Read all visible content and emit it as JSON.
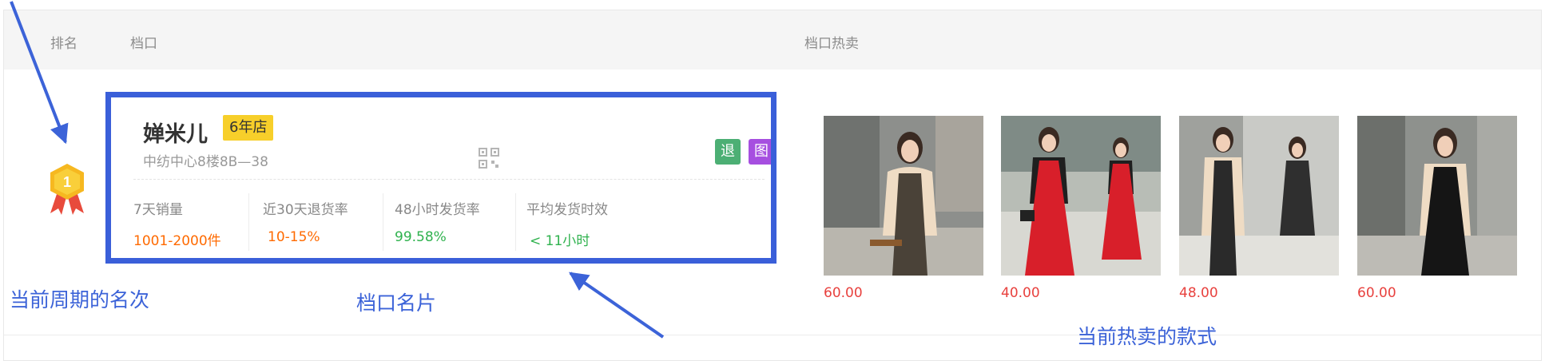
{
  "header": {
    "rank": "排名",
    "stall": "档口",
    "hot": "档口热卖"
  },
  "row": {
    "rank_number": "1",
    "card": {
      "name": "婵米儿",
      "years_badge": "6年店",
      "address": "中纺中心8楼8B—38",
      "tags": [
        "退",
        "图"
      ],
      "stats": [
        {
          "label": "7天销量",
          "value": "1001-2000件",
          "color": "#ff6a00"
        },
        {
          "label": "近30天退货率",
          "value": "10-15%",
          "color": "#ff6a00"
        },
        {
          "label": "48小时发货率",
          "value": "99.58%",
          "color": "#2fb24e"
        },
        {
          "label": "平均发货时效",
          "value": "< 11小时",
          "color": "#2fb24e"
        }
      ]
    },
    "products": [
      {
        "price": "60.00"
      },
      {
        "price": "40.00"
      },
      {
        "price": "48.00"
      },
      {
        "price": "60.00"
      }
    ]
  },
  "annotations": {
    "rank_note": "当前周期的名次",
    "card_note": "档口名片",
    "hot_note": "当前热卖的款式"
  },
  "colors": {
    "annotation_blue": "#3c63d8",
    "price_red": "#e8413e",
    "badge_yellow": "#f7cf2a"
  }
}
